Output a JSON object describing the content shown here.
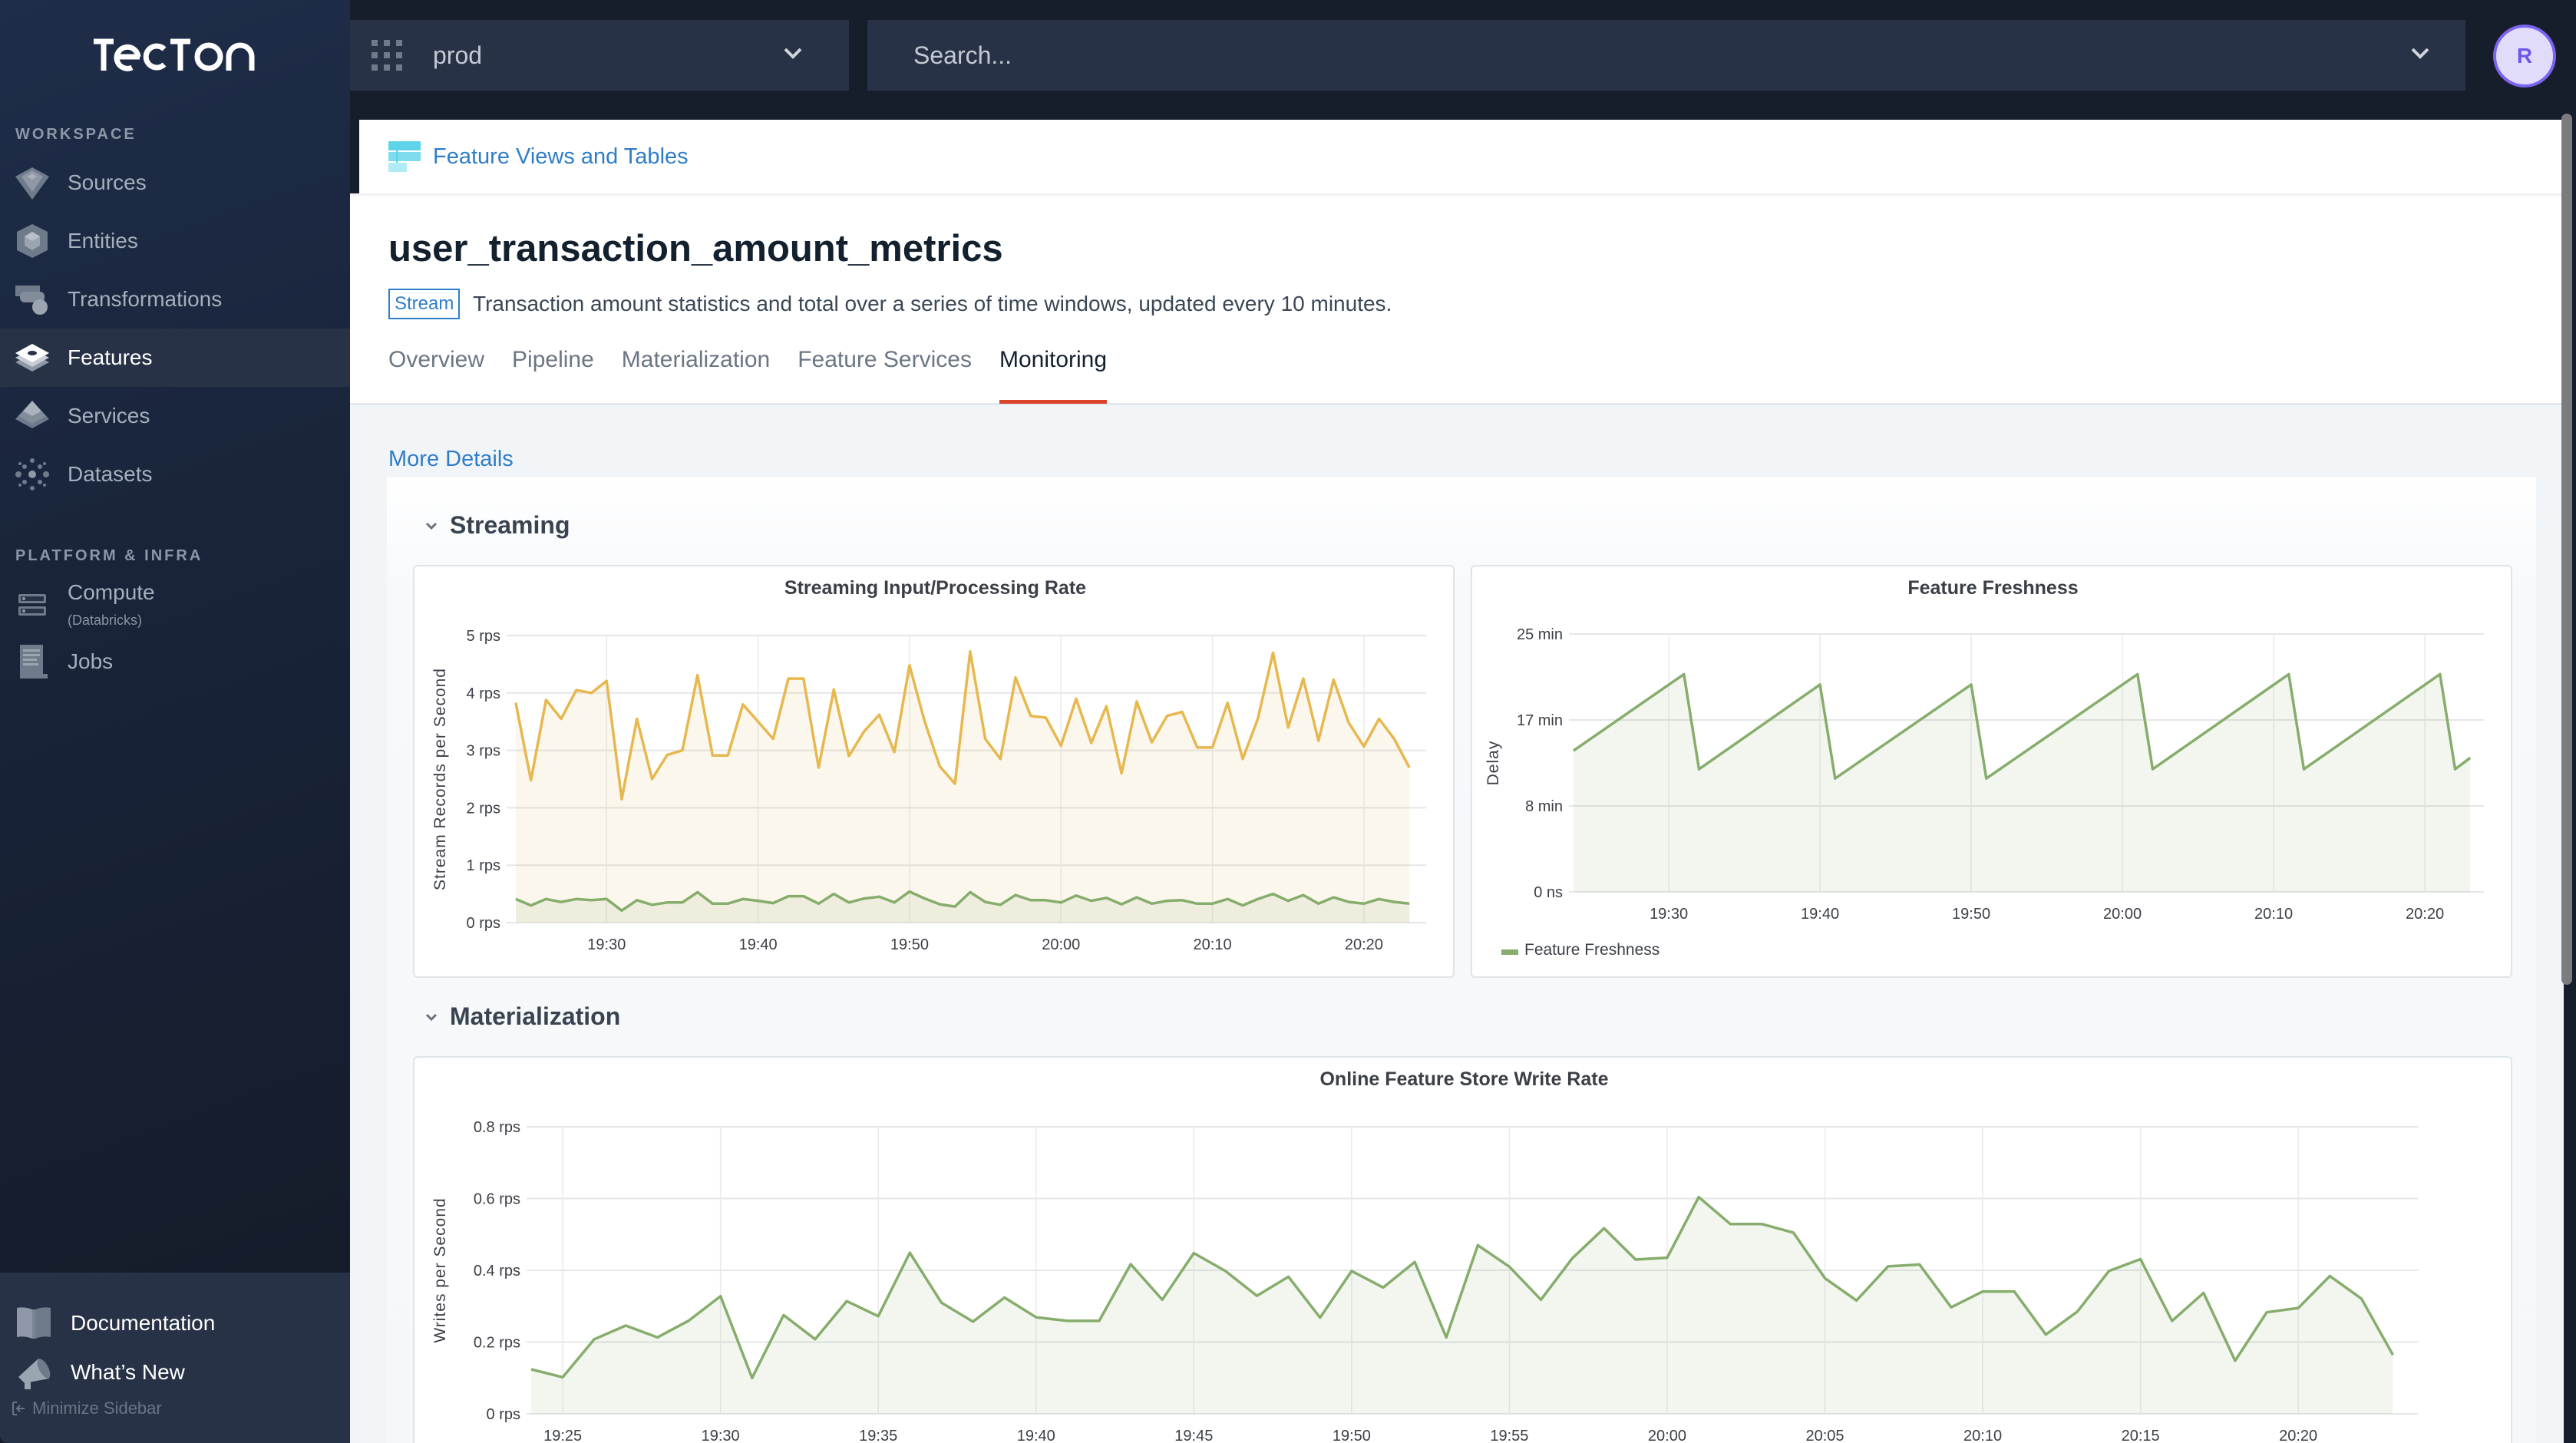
{
  "app": {
    "logo": "tecton"
  },
  "sidebar": {
    "workspace_label": "WORKSPACE",
    "workspace_items": [
      {
        "label": "Sources",
        "icon": "diamond-icon",
        "active": false
      },
      {
        "label": "Entities",
        "icon": "cube-icon",
        "active": false
      },
      {
        "label": "Transformations",
        "icon": "shapes-icon",
        "active": false
      },
      {
        "label": "Features",
        "icon": "layers-icon",
        "active": true
      },
      {
        "label": "Services",
        "icon": "pyramid-icon",
        "active": false
      },
      {
        "label": "Datasets",
        "icon": "dots-cluster-icon",
        "active": false
      }
    ],
    "platform_label": "PLATFORM & INFRA",
    "platform_items": [
      {
        "label": "Compute",
        "sublabel": "(Databricks)",
        "icon": "server-icon"
      },
      {
        "label": "Jobs",
        "icon": "document-icon"
      }
    ],
    "bottom_items": [
      {
        "label": "Documentation",
        "icon": "book-icon"
      },
      {
        "label": "What’s New",
        "icon": "megaphone-icon"
      }
    ],
    "minimize_label": "Minimize Sidebar"
  },
  "topbar": {
    "workspace_value": "prod",
    "search_placeholder": "Search...",
    "avatar_initial": "R"
  },
  "breadcrumb": {
    "label": "Feature Views and Tables"
  },
  "header": {
    "title": "user_transaction_amount_metrics",
    "badge": "Stream",
    "description": "Transaction amount statistics and total over a series of time windows, updated every 10 minutes.",
    "tabs": [
      {
        "label": "Overview",
        "active": false
      },
      {
        "label": "Pipeline",
        "active": false
      },
      {
        "label": "Materialization",
        "active": false
      },
      {
        "label": "Feature Services",
        "active": false
      },
      {
        "label": "Monitoring",
        "active": true
      }
    ]
  },
  "monitoring": {
    "more_details": "More Details",
    "sections": [
      {
        "title": "Streaming"
      },
      {
        "title": "Materialization"
      }
    ]
  },
  "colors": {
    "accent_link": "#2f7dc8",
    "tab_underline": "#d9432b",
    "series_input": "#e6b84f",
    "series_processing": "#86ad6c",
    "avatar_ring": "#7a63f0"
  },
  "chart_data": [
    {
      "id": "streaming-rate",
      "type": "area",
      "title": "Streaming Input/Processing Rate",
      "xlabel": "",
      "ylabel": "Stream Records per Second",
      "x_start": "19:24",
      "x_step_minutes": 1,
      "x_ticks": [
        "19:30",
        "19:40",
        "19:50",
        "20:00",
        "20:10",
        "20:20"
      ],
      "y_ticks": [
        "0 rps",
        "1 rps",
        "2 rps",
        "3 rps",
        "4 rps",
        "5 rps"
      ],
      "ylim": [
        0,
        5
      ],
      "grid": true,
      "legend": "none",
      "series": [
        {
          "name": "Input Rate",
          "color": "#e6b84f",
          "values": [
            3.83,
            2.48,
            3.88,
            3.55,
            4.05,
            4.0,
            4.21,
            2.15,
            3.55,
            2.5,
            2.92,
            3.0,
            4.31,
            2.91,
            2.91,
            3.8,
            3.5,
            3.2,
            4.25,
            4.25,
            2.7,
            4.06,
            2.9,
            3.33,
            3.62,
            2.97,
            4.48,
            3.5,
            2.72,
            2.42,
            4.72,
            3.2,
            2.85,
            4.27,
            3.6,
            3.57,
            3.08,
            3.9,
            3.13,
            3.77,
            2.6,
            3.85,
            3.14,
            3.6,
            3.67,
            3.05,
            3.05,
            3.83,
            2.85,
            3.55,
            4.7,
            3.4,
            4.25,
            3.17,
            4.23,
            3.48,
            3.07,
            3.55,
            3.2,
            2.7
          ]
        },
        {
          "name": "Processing Rate",
          "color": "#86ad6c",
          "values": [
            0.41,
            0.3,
            0.41,
            0.36,
            0.41,
            0.39,
            0.41,
            0.21,
            0.39,
            0.31,
            0.35,
            0.35,
            0.53,
            0.33,
            0.33,
            0.41,
            0.38,
            0.34,
            0.46,
            0.46,
            0.33,
            0.5,
            0.35,
            0.42,
            0.45,
            0.35,
            0.54,
            0.42,
            0.32,
            0.28,
            0.53,
            0.36,
            0.31,
            0.48,
            0.39,
            0.39,
            0.35,
            0.47,
            0.38,
            0.43,
            0.32,
            0.44,
            0.33,
            0.38,
            0.39,
            0.33,
            0.33,
            0.41,
            0.3,
            0.41,
            0.5,
            0.38,
            0.48,
            0.33,
            0.44,
            0.36,
            0.33,
            0.41,
            0.36,
            0.33
          ]
        }
      ]
    },
    {
      "id": "feature-freshness",
      "type": "area",
      "title": "Feature Freshness",
      "xlabel": "",
      "ylabel": "Delay",
      "x_ticks": [
        "19:30",
        "19:40",
        "19:50",
        "20:00",
        "20:10",
        "20:20"
      ],
      "y_ticks": [
        "0 ns",
        "8 min",
        "17 min",
        "25 min"
      ],
      "ylim_minutes": [
        0,
        25
      ],
      "grid": true,
      "legend": "bottom-left",
      "series": [
        {
          "name": "Feature Freshness",
          "color": "#86ad6c",
          "points": [
            {
              "t": "19:23.7",
              "v": 13.7
            },
            {
              "t": "19:31",
              "v": 21.1
            },
            {
              "t": "19:32",
              "v": 11.9
            },
            {
              "t": "19:40",
              "v": 20.1
            },
            {
              "t": "19:41",
              "v": 11.0
            },
            {
              "t": "19:50",
              "v": 20.1
            },
            {
              "t": "19:51",
              "v": 11.0
            },
            {
              "t": "20:01",
              "v": 21.1
            },
            {
              "t": "20:02",
              "v": 11.9
            },
            {
              "t": "20:11",
              "v": 21.1
            },
            {
              "t": "20:12",
              "v": 11.9
            },
            {
              "t": "20:21",
              "v": 21.1
            },
            {
              "t": "20:22",
              "v": 11.9
            },
            {
              "t": "20:23",
              "v": 13.0
            }
          ]
        }
      ]
    },
    {
      "id": "online-write-rate",
      "type": "area",
      "title": "Online Feature Store Write Rate",
      "xlabel": "",
      "ylabel": "Writes per Second",
      "x_start": "19:24",
      "x_step_minutes": 1,
      "x_ticks": [
        "19:25",
        "19:30",
        "19:35",
        "19:40",
        "19:45",
        "19:50",
        "19:55",
        "20:00",
        "20:05",
        "20:10",
        "20:15",
        "20:20"
      ],
      "y_ticks": [
        "0 rps",
        "0.2 rps",
        "0.4 rps",
        "0.6 rps",
        "0.8 rps"
      ],
      "ylim": [
        0,
        0.8
      ],
      "grid": true,
      "legend": "none",
      "series": [
        {
          "name": "Write Rate",
          "color": "#86ad6c",
          "values": [
            0.124,
            0.102,
            0.208,
            0.246,
            0.213,
            0.26,
            0.328,
            0.1,
            0.275,
            0.208,
            0.314,
            0.272,
            0.449,
            0.31,
            0.257,
            0.324,
            0.269,
            0.259,
            0.259,
            0.417,
            0.318,
            0.448,
            0.398,
            0.329,
            0.382,
            0.268,
            0.398,
            0.352,
            0.423,
            0.213,
            0.47,
            0.41,
            0.318,
            0.434,
            0.517,
            0.43,
            0.435,
            0.604,
            0.529,
            0.529,
            0.505,
            0.378,
            0.316,
            0.411,
            0.416,
            0.297,
            0.341,
            0.341,
            0.221,
            0.285,
            0.398,
            0.431,
            0.259,
            0.337,
            0.148,
            0.283,
            0.295,
            0.384,
            0.321,
            0.164
          ]
        }
      ]
    }
  ]
}
